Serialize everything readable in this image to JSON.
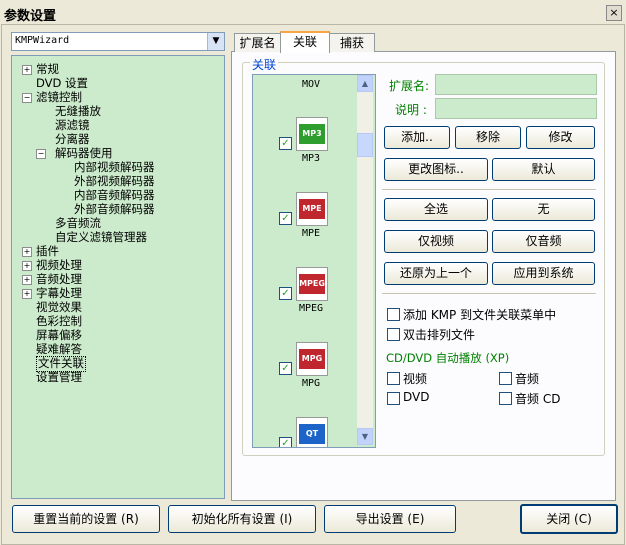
{
  "window": {
    "title": "参数设置",
    "close_glyph": "×"
  },
  "profile": {
    "selected": "KMPWizard"
  },
  "tree": [
    {
      "label": "常规",
      "toggle": "+",
      "level": 0
    },
    {
      "label": "DVD 设置",
      "toggle": "",
      "level": 0
    },
    {
      "label": "滤镜控制",
      "toggle": "−",
      "level": 0
    },
    {
      "label": "无缝播放",
      "toggle": "",
      "level": 1
    },
    {
      "label": "源滤镜",
      "toggle": "",
      "level": 1
    },
    {
      "label": "分离器",
      "toggle": "",
      "level": 1
    },
    {
      "label": "解码器使用",
      "toggle": "−",
      "level": 1
    },
    {
      "label": "内部视频解码器",
      "toggle": "",
      "level": 2
    },
    {
      "label": "外部视频解码器",
      "toggle": "",
      "level": 2
    },
    {
      "label": "内部音频解码器",
      "toggle": "",
      "level": 2
    },
    {
      "label": "外部音频解码器",
      "toggle": "",
      "level": 2
    },
    {
      "label": "多音频流",
      "toggle": "",
      "level": 1
    },
    {
      "label": "自定义滤镜管理器",
      "toggle": "",
      "level": 1
    },
    {
      "label": "插件",
      "toggle": "+",
      "level": 0
    },
    {
      "label": "视频处理",
      "toggle": "+",
      "level": 0
    },
    {
      "label": "音频处理",
      "toggle": "+",
      "level": 0
    },
    {
      "label": "字幕处理",
      "toggle": "+",
      "level": 0
    },
    {
      "label": "视觉效果",
      "toggle": "",
      "level": 0
    },
    {
      "label": "色彩控制",
      "toggle": "",
      "level": 0
    },
    {
      "label": "屏幕偏移",
      "toggle": "",
      "level": 0
    },
    {
      "label": "疑难解答",
      "toggle": "",
      "level": 0
    },
    {
      "label": "文件关联",
      "toggle": "",
      "level": 0,
      "selected": true
    },
    {
      "label": "设置管理",
      "toggle": "",
      "level": 0
    }
  ],
  "tabs": [
    {
      "label": "扩展名",
      "active": false
    },
    {
      "label": "关联",
      "active": true
    },
    {
      "label": "捕获",
      "active": false
    }
  ],
  "group_title": "关联",
  "ext_list": [
    {
      "name": "MOV",
      "badge": "",
      "checked": false,
      "color": ""
    },
    {
      "name": "MP3",
      "badge": "MP3",
      "checked": true,
      "color": "#2e9e2e"
    },
    {
      "name": "MPE",
      "badge": "MPE",
      "checked": true,
      "color": "#c0262d"
    },
    {
      "name": "MPEG",
      "badge": "MPEG",
      "checked": true,
      "color": "#c0262d"
    },
    {
      "name": "MPG",
      "badge": "MPG",
      "checked": true,
      "color": "#c0262d"
    },
    {
      "name": "",
      "badge": "QT",
      "checked": true,
      "color": "#1c64c8"
    }
  ],
  "fields": {
    "ext_label": "扩展名:",
    "desc_label": "说明 :",
    "ext_value": "",
    "desc_value": ""
  },
  "buttons": {
    "add": "添加..",
    "remove": "移除",
    "modify": "修改",
    "change_icon": "更改图标..",
    "default": "默认",
    "select_all": "全选",
    "none": "无",
    "video_only": "仅视频",
    "audio_only": "仅音频",
    "restore_prev": "还原为上一个",
    "apply_system": "应用到系统"
  },
  "options": {
    "add_context": "添加 KMP 到文件关联菜单中",
    "dblclick_sort": "双击排列文件",
    "cd_title": "CD/DVD 自动播放 (XP)",
    "video": "视频",
    "audio": "音频",
    "dvd": "DVD",
    "audio_cd": "音频 CD"
  },
  "footer": {
    "reset": "重置当前的设置 (R)",
    "init_all": "初始化所有设置 (I)",
    "export": "导出设置 (E)",
    "close": "关闭 (C)"
  },
  "icons": {
    "combo_arrow": "chevron-down-icon",
    "scroll_up": "arrow-up-icon",
    "scroll_down": "arrow-down-icon",
    "check": "checkmark-icon"
  }
}
